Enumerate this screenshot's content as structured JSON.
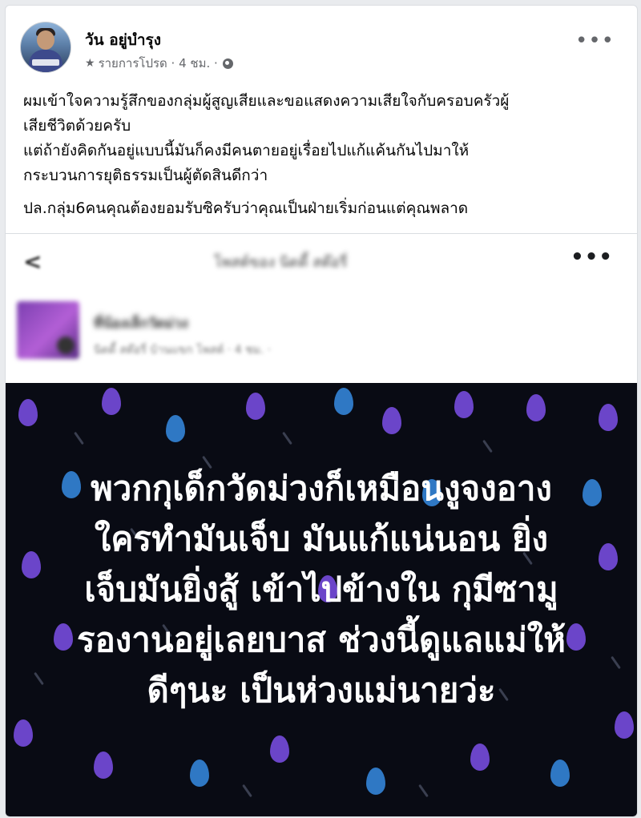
{
  "post": {
    "author": "วัน อยู่บำรุง",
    "meta_text": "รายการโปรด · 4 ชม. ·",
    "icons": {
      "favorite": "star-icon",
      "audience": "globe-icon",
      "more": "more-options-icon"
    },
    "more_label": "•••",
    "paragraphs": [
      "ผมเข้าใจความรู้สึกของกลุ่มผู้สูญเสียและขอแสดงความเสียใจกับครอบครัวผู้",
      "เสียชีวิตด้วยครับ",
      "แต่ถ้ายังคิดกันอยู่แบบนี้มันก็คงมีคนตายอยู่เรื่อยไปแก้แค้นกันไปมาให้",
      "กระบวนการยุติธรรมเป็นผู้ตัดสินดีกว่า",
      "ปล.กลุ่ม6คนคุณต้องยอมรับซิครับว่าคุณเป็นฝ่ายเริ่มก่อนแต่คุณพลาด"
    ]
  },
  "shared_screenshot": {
    "back_glyph": "<",
    "more_label": "•••",
    "blurred_title": "โพสต์ของ นิดดี้ สต๊อรี่",
    "blurred_name": "ที่น้องเล็กวัดม่วง",
    "blurred_meta": "นิดดี้ สต๊อรี่ บ้านแขก โพสต์ · 4 ชม. ·",
    "caption_lines": [
      "พวกกุเด็กวัดม่วงก็เหมือนงูจงอาง",
      "ใครทำมันเจ็บ มันแก้แน่นอน ยิ่ง",
      "เจ็บมันยิ่งสู้ เข้าไปข้างใน กุมีซามู",
      "รองานอยู่เลยบาส ช่วงนี้ดูแลแม่ให้",
      "ดีๆนะ เป็นห่วงแม่นายว่ะ"
    ]
  },
  "colors": {
    "page_bg": "#e9ebee",
    "text_primary": "#050505",
    "text_secondary": "#65676b",
    "image_bg": "#090b14",
    "drop_purple": "#6b45c9",
    "drop_blue": "#2f78c4"
  }
}
